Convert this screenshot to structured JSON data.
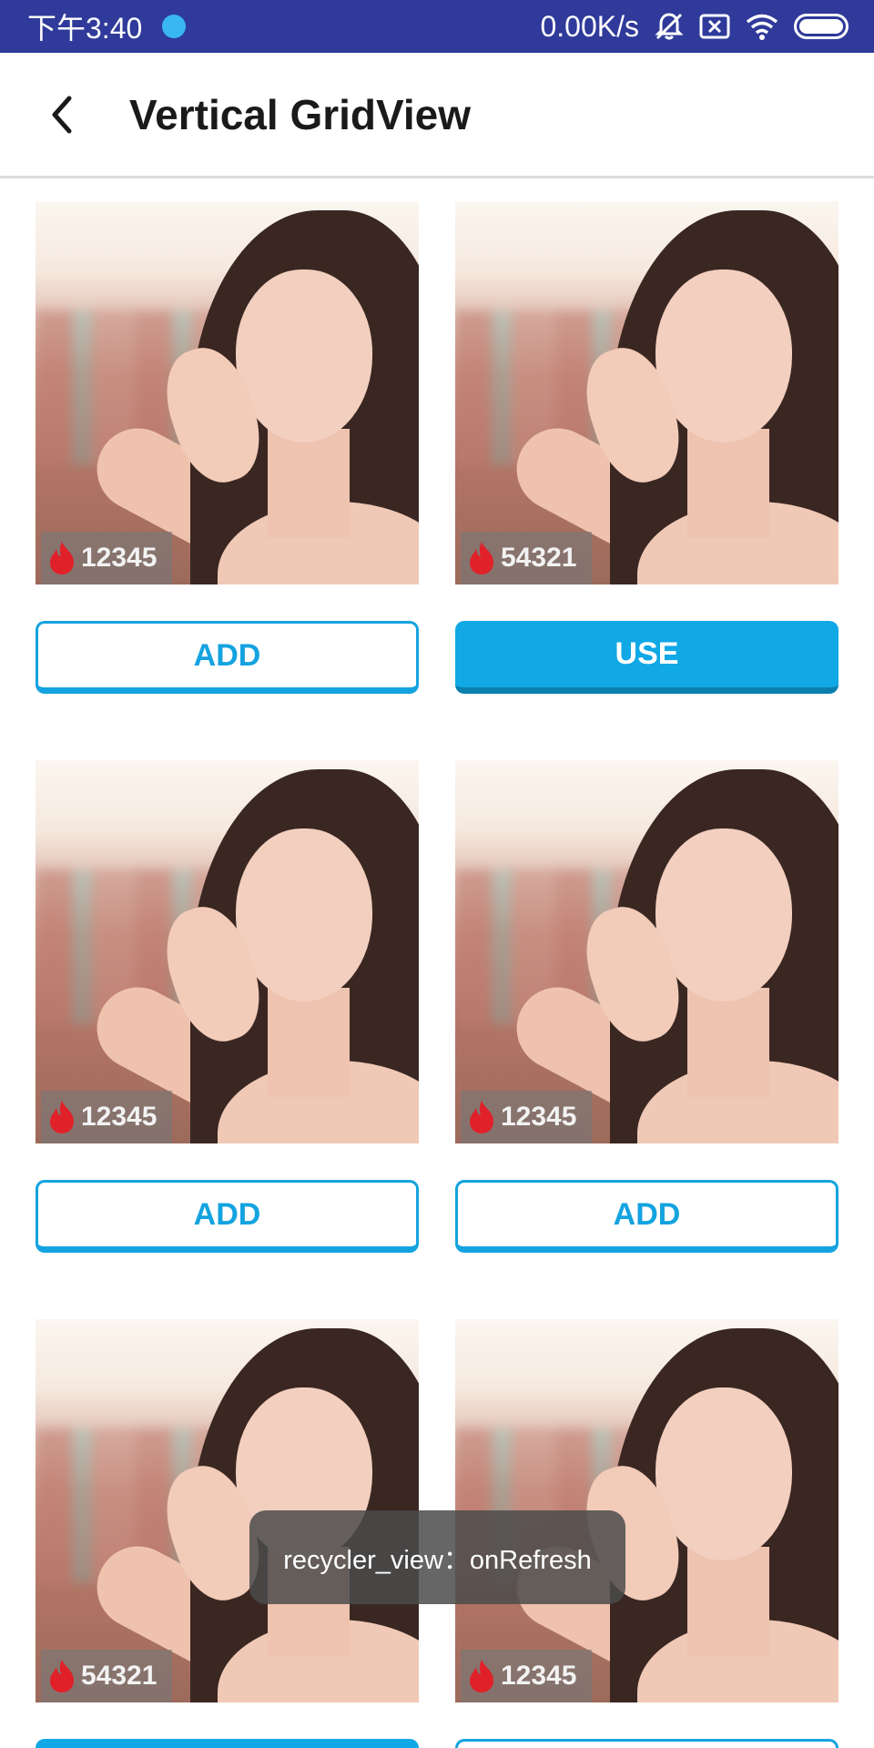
{
  "status_bar": {
    "time": "下午3:40",
    "network_speed": "0.00K/s",
    "icons": [
      "app-notification-dot",
      "mute-bell-icon",
      "sim-off-icon",
      "wifi-icon",
      "battery-icon"
    ]
  },
  "app_bar": {
    "title": "Vertical GridView",
    "back_icon": "chevron-left-icon"
  },
  "grid": {
    "items": [
      {
        "count": "12345",
        "button": "ADD",
        "button_style": "outline"
      },
      {
        "count": "54321",
        "button": "USE",
        "button_style": "filled"
      },
      {
        "count": "12345",
        "button": "ADD",
        "button_style": "outline"
      },
      {
        "count": "12345",
        "button": "ADD",
        "button_style": "outline"
      },
      {
        "count": "54321",
        "button": "",
        "button_style": "filled"
      },
      {
        "count": "12345",
        "button": "",
        "button_style": "outline"
      }
    ],
    "badge_icon": "flame-icon"
  },
  "toast": {
    "message": "recycler_view：onRefresh"
  },
  "colors": {
    "status_bar": "#2f3a9a",
    "accent": "#14a3e0",
    "flame": "#e0212a"
  }
}
